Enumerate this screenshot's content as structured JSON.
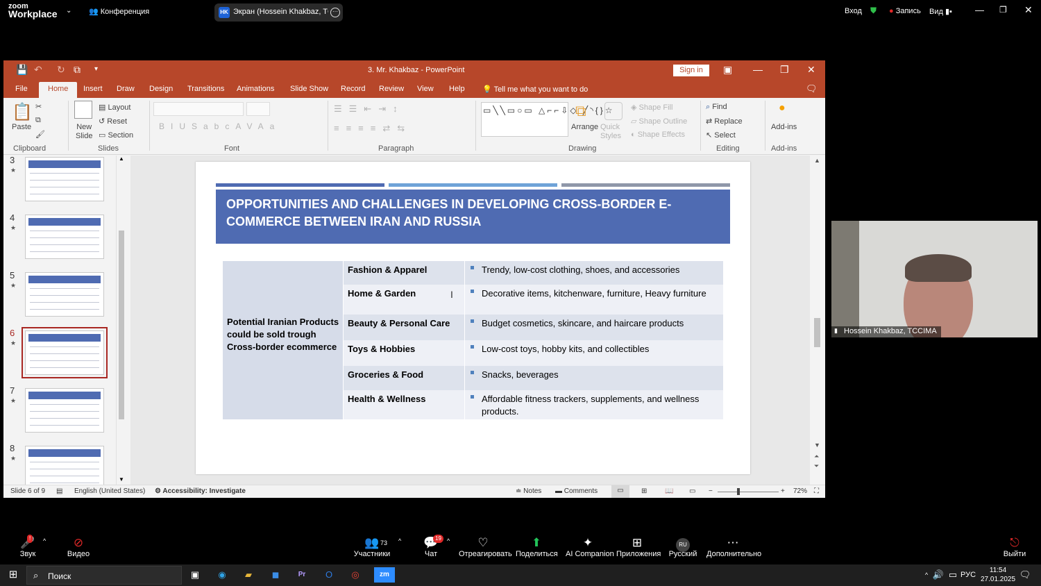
{
  "zoom_top": {
    "brand_small": "zoom",
    "brand": "Workplace",
    "conference": "Конференция",
    "share_title": "Экран (Hossein Khakbaz, TCCIM)",
    "share_initials": "HK",
    "login": "Вход",
    "record": "Запись",
    "view": "Вид"
  },
  "ppt": {
    "title": "3. Mr. Khakbaz  -  PowerPoint",
    "signin": "Sign in",
    "tabs": [
      "File",
      "Home",
      "Insert",
      "Draw",
      "Design",
      "Transitions",
      "Animations",
      "Slide Show",
      "Record",
      "Review",
      "View",
      "Help"
    ],
    "tell_me": "Tell me what you want to do",
    "ribbon": {
      "paste": "Paste",
      "clipboard": "Clipboard",
      "new_slide_1": "New",
      "new_slide_2": "Slide",
      "layout": "Layout",
      "reset": "Reset",
      "section": "Section",
      "slides": "Slides",
      "font": "Font",
      "paragraph": "Paragraph",
      "arrange": "Arrange",
      "quick_styles_1": "Quick",
      "quick_styles_2": "Styles",
      "shape_fill": "Shape Fill",
      "shape_outline": "Shape Outline",
      "shape_effects": "Shape Effects",
      "drawing": "Drawing",
      "find": "Find",
      "replace": "Replace",
      "select": "Select",
      "editing": "Editing",
      "addins": "Add-ins",
      "addins_group": "Add-ins"
    },
    "thumbnails": [
      {
        "num": "3"
      },
      {
        "num": "4"
      },
      {
        "num": "5"
      },
      {
        "num": "6"
      },
      {
        "num": "7"
      },
      {
        "num": "8"
      }
    ],
    "selected_slide": "6",
    "slide": {
      "title": "OPPORTUNITIES AND CHALLENGES IN DEVELOPING CROSS-BORDER E-COMMERCE BETWEEN IRAN AND RUSSIA",
      "category_label": "Potential Iranian Products could be sold trough Cross-border ecommerce",
      "rows": [
        {
          "category": "Fashion & Apparel",
          "detail": "Trendy, low-cost clothing, shoes, and accessories"
        },
        {
          "category": "Home & Garden",
          "detail": "Decorative items, kitchenware, furniture, Heavy furniture"
        },
        {
          "category": "Beauty & Personal Care",
          "detail": "Budget cosmetics, skincare, and haircare products"
        },
        {
          "category": "Toys & Hobbies",
          "detail": "Low-cost toys, hobby kits, and collectibles"
        },
        {
          "category": "Groceries & Food",
          "detail": "Snacks, beverages"
        },
        {
          "category": "Health & Wellness",
          "detail": "Affordable fitness trackers, supplements, and wellness products."
        }
      ],
      "bar_colors": [
        "#4f6bb2",
        "#6fa3d8",
        "#8f97a9"
      ],
      "accent": "#4f6bb2"
    },
    "status": {
      "slide_of": "Slide 6 of 9",
      "language": "English (United States)",
      "accessibility": "Accessibility: Investigate",
      "notes": "Notes",
      "comments": "Comments",
      "zoom": "72%"
    }
  },
  "video": {
    "participant": "Hossein Khakbaz, TCCIMA"
  },
  "zoom_bar": {
    "audio": "Звук",
    "video": "Видео",
    "participants": "Участники",
    "participants_count": "73",
    "chat": "Чат",
    "chat_badge": "19",
    "react": "Отреагировать",
    "share": "Поделиться",
    "ai": "AI Companion",
    "apps": "Приложения",
    "language": "Русский",
    "language_code": "RU",
    "more": "Дополнительно",
    "leave": "Выйти"
  },
  "taskbar": {
    "search": "Поиск",
    "lang": "РУС",
    "time": "11:54",
    "date": "27.01.2025"
  }
}
